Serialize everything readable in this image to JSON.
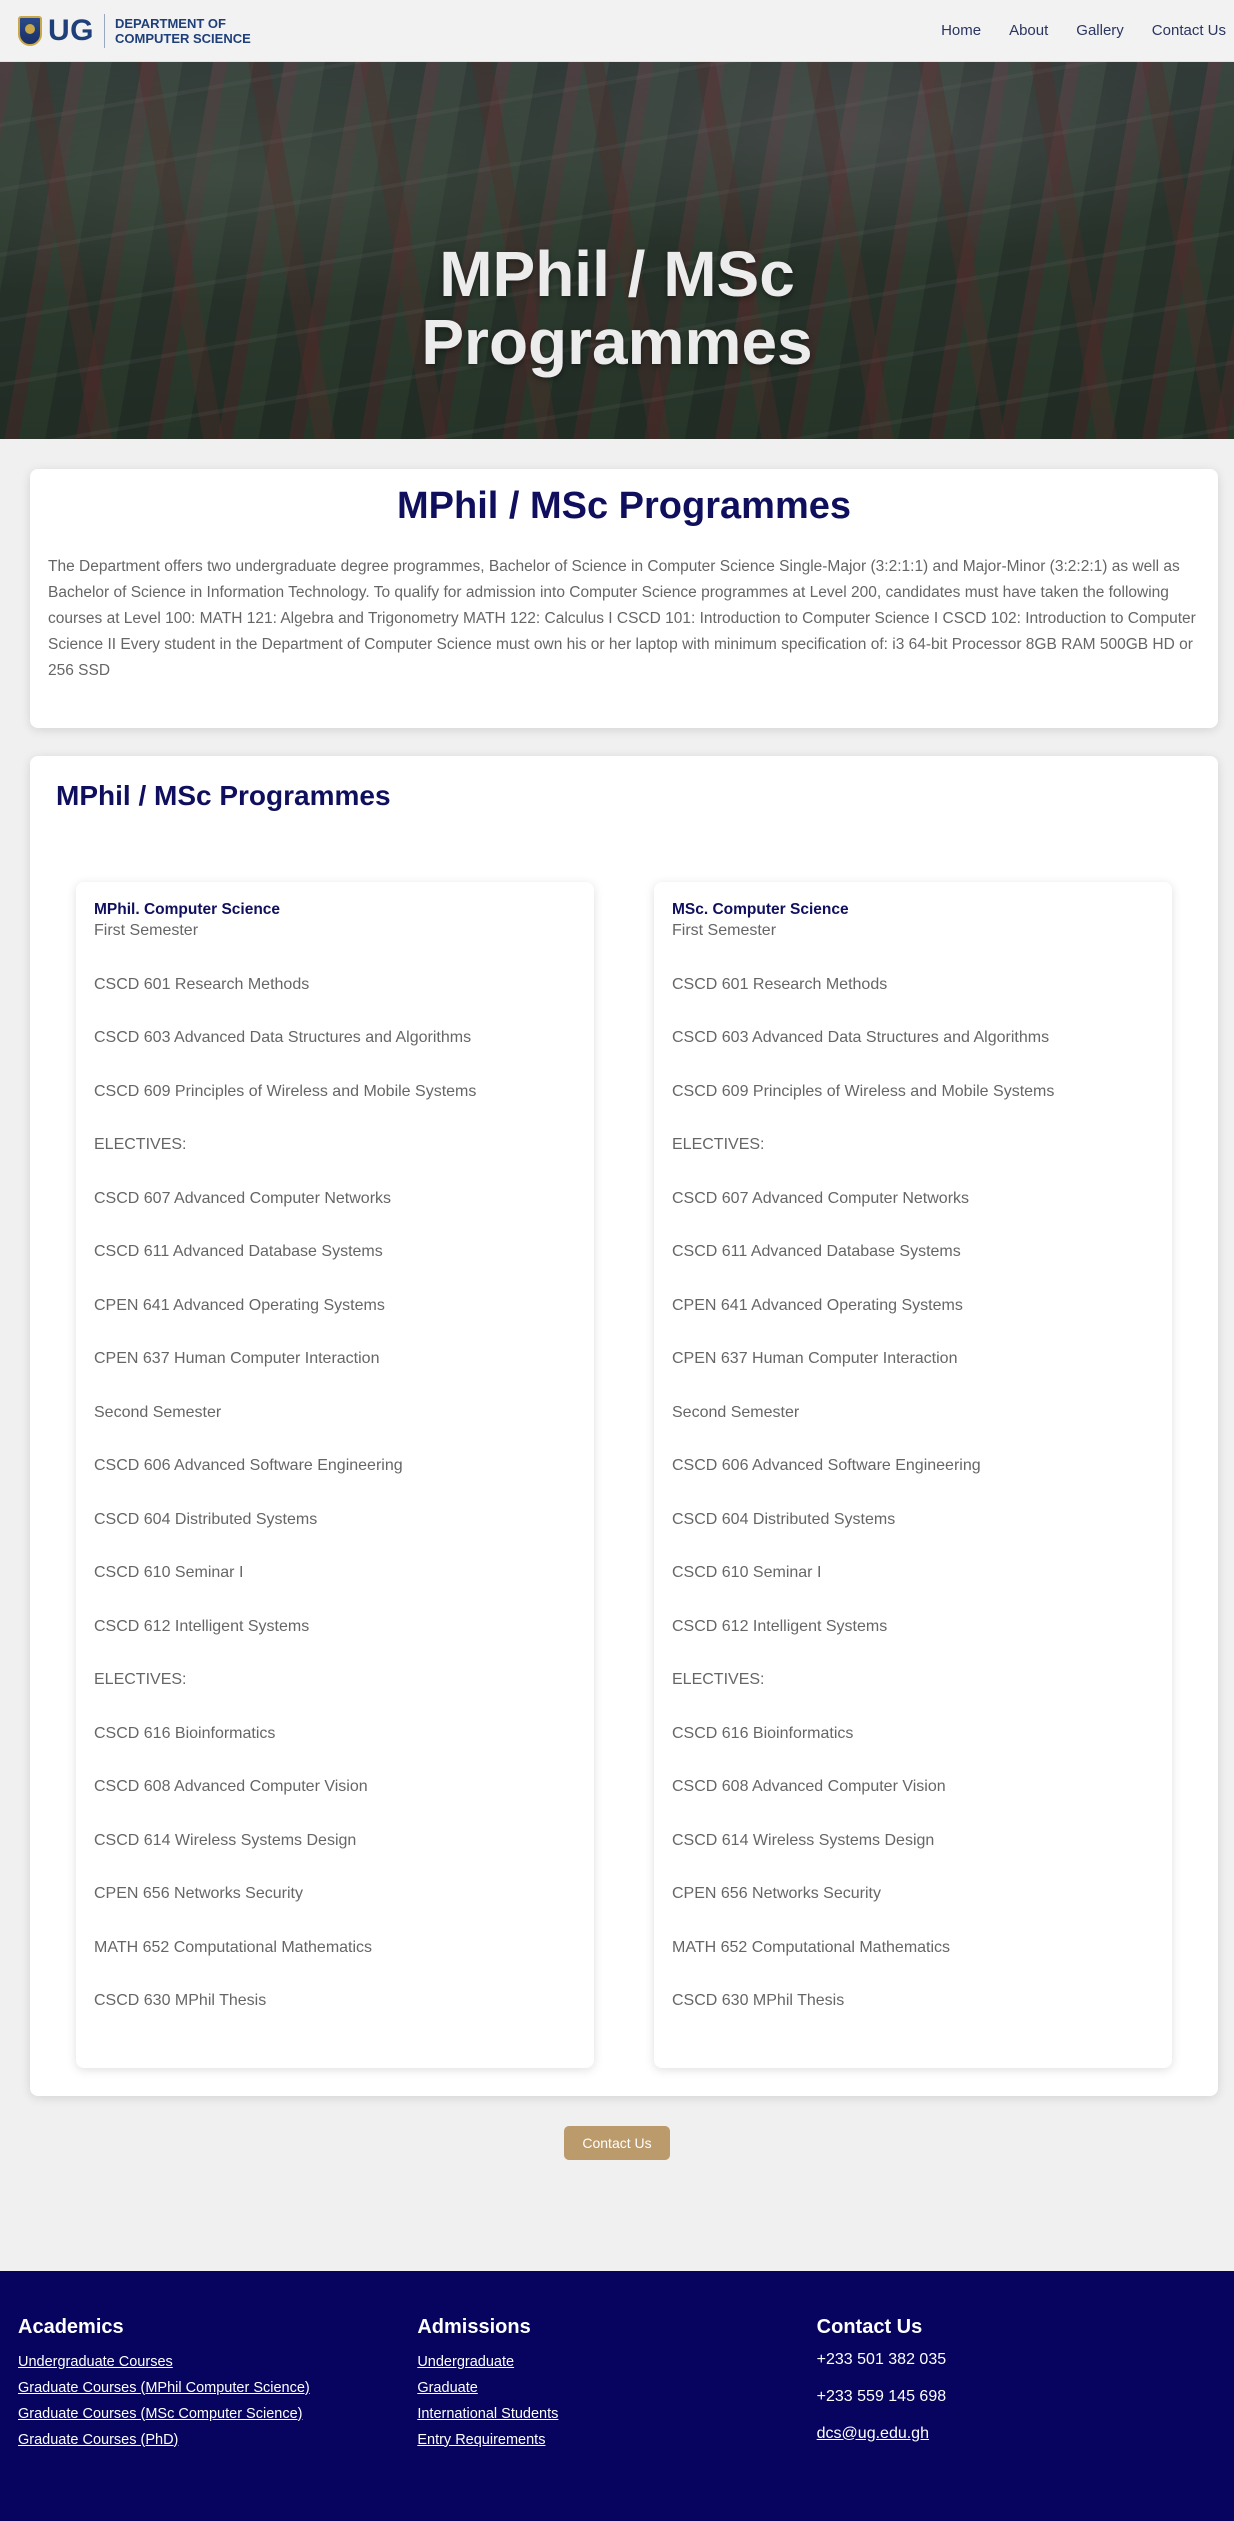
{
  "nav": {
    "brand_short": "UG",
    "brand_line1": "DEPARTMENT OF",
    "brand_line2": "COMPUTER SCIENCE",
    "links": [
      "Home",
      "About",
      "Gallery",
      "Contact Us"
    ]
  },
  "hero": {
    "title_line1": "MPhil / MSc",
    "title_line2": "Programmes"
  },
  "intro": {
    "title": "MPhil / MSc Programmes",
    "text": "The Department offers two undergraduate degree programmes, Bachelor of Science in Computer Science Single-Major (3:2:1:1) and Major-Minor (3:2:2:1) as well as Bachelor of Science in Information Technology. To qualify for admission into Computer Science programmes at Level 200, candidates must have taken the following courses at Level 100: MATH 121: Algebra and Trigonometry MATH 122: Calculus I CSCD 101: Introduction to Computer Science I CSCD 102: Introduction to Computer Science II Every student in the Department of Computer Science must own his or her laptop with minimum specification of: i3 64-bit Processor 8GB RAM 500GB HD or 256 SSD"
  },
  "programmes": {
    "heading": "MPhil / MSc Programmes",
    "columns": [
      {
        "title": "MPhil. Computer Science",
        "items": [
          "First Semester",
          "CSCD 601 Research Methods",
          "CSCD 603 Advanced Data Structures and Algorithms",
          "CSCD 609 Principles of Wireless and Mobile Systems",
          "ELECTIVES:",
          "CSCD 607 Advanced Computer Networks",
          "CSCD 611 Advanced Database Systems",
          "CPEN 641 Advanced Operating Systems",
          "CPEN 637 Human Computer Interaction",
          "Second Semester",
          "CSCD 606 Advanced Software Engineering",
          "CSCD 604 Distributed Systems",
          "CSCD 610 Seminar I",
          "CSCD 612 Intelligent Systems",
          "ELECTIVES:",
          "CSCD 616 Bioinformatics",
          "CSCD 608 Advanced Computer Vision",
          "CSCD 614 Wireless Systems Design",
          "CPEN 656 Networks Security",
          "MATH 652 Computational Mathematics",
          "CSCD 630 MPhil Thesis"
        ]
      },
      {
        "title": "MSc. Computer Science",
        "items": [
          "First Semester",
          "CSCD 601 Research Methods",
          "CSCD 603 Advanced Data Structures and Algorithms",
          "CSCD 609 Principles of Wireless and Mobile Systems",
          "ELECTIVES:",
          "CSCD 607 Advanced Computer Networks",
          "CSCD 611 Advanced Database Systems",
          "CPEN 641 Advanced Operating Systems",
          "CPEN 637 Human Computer Interaction",
          "Second Semester",
          "CSCD 606 Advanced Software Engineering",
          "CSCD 604 Distributed Systems",
          "CSCD 610 Seminar I",
          "CSCD 612 Intelligent Systems",
          "ELECTIVES:",
          "CSCD 616 Bioinformatics",
          "CSCD 608 Advanced Computer Vision",
          "CSCD 614 Wireless Systems Design",
          "CPEN 656 Networks Security",
          "MATH 652 Computational Mathematics",
          "CSCD 630 MPhil Thesis"
        ]
      }
    ]
  },
  "cta": {
    "label": "Contact Us"
  },
  "footer": {
    "academics": {
      "title": "Academics",
      "links": [
        "Undergraduate Courses",
        "Graduate Courses (MPhil Computer Science)",
        "Graduate Courses (MSc Computer Science)",
        "Graduate Courses (PhD)"
      ]
    },
    "admissions": {
      "title": "Admissions",
      "links": [
        "Undergraduate",
        "Graduate",
        "International Students",
        "Entry Requirements"
      ]
    },
    "contact": {
      "title": "Contact Us",
      "lines": [
        "+233 501 382 035",
        "+233 559 145 698",
        "dcs@ug.edu.gh"
      ]
    }
  },
  "colors": {
    "navy": "#0f0f5e",
    "footer_bg": "#06045e",
    "button": "#bb9a6b"
  }
}
